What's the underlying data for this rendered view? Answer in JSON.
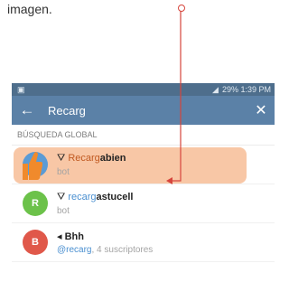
{
  "caption": "imagen.",
  "status_bar": {
    "left_icon": "notification-icon",
    "right_text": "29% 1:39 PM"
  },
  "toolbar": {
    "back_icon": "←",
    "query": "Recarg",
    "close_icon": "✕"
  },
  "section_header": "BÚSQUEDA GLOBAL",
  "results": [
    {
      "glyph": "⛛",
      "prefix": "Recarg",
      "match": "abien",
      "subtitle": "bot",
      "avatar_letter": "",
      "avatar_color": "#f08a2c"
    },
    {
      "glyph": "⛛",
      "prefix": "recarg",
      "match": "astucell",
      "subtitle": "bot",
      "avatar_letter": "R",
      "avatar_color": "#6cc24a"
    },
    {
      "glyph": "◂",
      "prefix": "",
      "match": "Bhh",
      "subtitle_handle": "@recarg",
      "subtitle_rest": ", 4 suscriptores",
      "avatar_letter": "B",
      "avatar_color": "#e0584a"
    }
  ],
  "colors": {
    "toolbar": "#5b81a7",
    "status_bar": "#4e6e8c",
    "highlight": "#f8c7a6",
    "callout": "#d6453c"
  }
}
